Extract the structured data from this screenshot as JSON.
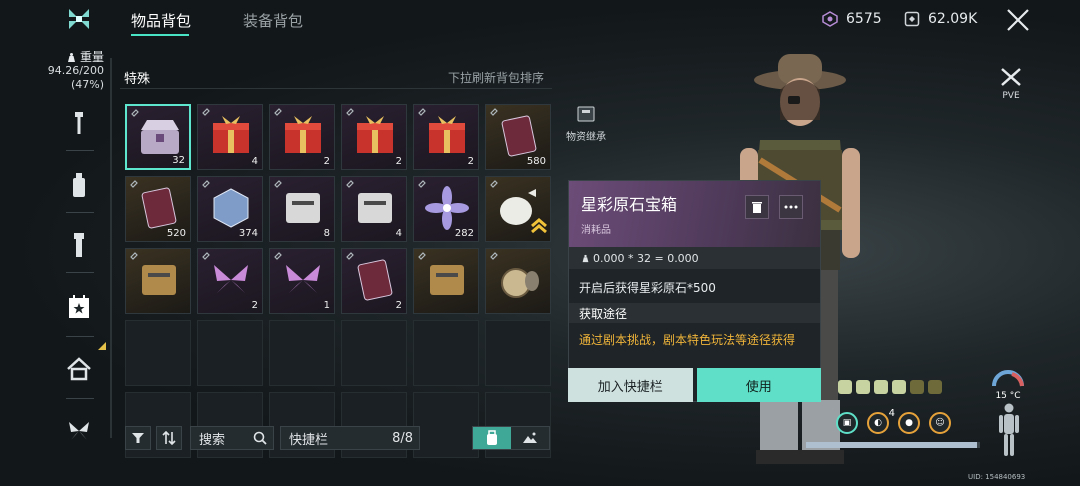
{
  "header": {
    "tabs": [
      {
        "label": "物品背包",
        "active": true
      },
      {
        "label": "装备背包",
        "active": false
      }
    ],
    "currency_gem": "6575",
    "currency_credit": "62.09K"
  },
  "left": {
    "weight_label": "重量",
    "weight_value": "94.26/200",
    "weight_pct": "(47%)",
    "rail_icons": [
      "wrench-icon",
      "bottle-icon",
      "flashlight-icon",
      "calendar-star-icon",
      "house-icon",
      "butterfly-icon"
    ]
  },
  "panel": {
    "category": "特殊",
    "refresh_hint": "下拉刷新背包排序",
    "slots": [
      {
        "item": "星彩原石宝箱",
        "qty": "32",
        "style": "purple",
        "selected": true
      },
      {
        "item": "礼盒",
        "qty": "4",
        "style": "purple"
      },
      {
        "item": "礼盒",
        "qty": "2",
        "style": "purple"
      },
      {
        "item": "礼盒",
        "qty": "2",
        "style": "purple"
      },
      {
        "item": "礼盒",
        "qty": "2",
        "style": "purple"
      },
      {
        "item": "卡片",
        "qty": "580",
        "style": "gold"
      },
      {
        "item": "卡片",
        "qty": "520",
        "style": "gold"
      },
      {
        "item": "魔方",
        "qty": "374",
        "style": "purple"
      },
      {
        "item": "盒子",
        "qty": "8",
        "style": "purple"
      },
      {
        "item": "背包",
        "qty": "4",
        "style": "purple"
      },
      {
        "item": "花",
        "qty": "282",
        "style": "purple"
      },
      {
        "item": "袋子",
        "qty": "",
        "style": "gold"
      },
      {
        "item": "地图",
        "qty": "",
        "style": "gold"
      },
      {
        "item": "蝴蝶",
        "qty": "2",
        "style": "purple"
      },
      {
        "item": "蝴蝶",
        "qty": "1",
        "style": "purple"
      },
      {
        "item": "卡片",
        "qty": "2",
        "style": "purple"
      },
      {
        "item": "文件",
        "qty": "",
        "style": "gold"
      },
      {
        "item": "怀表",
        "qty": "",
        "style": "gold"
      }
    ],
    "side_button_label": "物资继承"
  },
  "toolbar": {
    "search_label": "搜索",
    "quickbar_label": "快捷栏",
    "quickbar_count": "8/8"
  },
  "popup": {
    "name": "星彩原石宝箱",
    "type": "消耗品",
    "weight": "0.000 * 32 = 0.000",
    "description": "开启后获得星彩原石*500",
    "source_title": "获取途径",
    "source_text": "通过剧本挑战，剧本特色玩法等途径获得",
    "btn_quickbar": "加入快捷栏",
    "btn_use": "使用"
  },
  "right": {
    "mode_label": "PVE",
    "temperature": "15 °C",
    "gauge_badge": "4",
    "stamina_pct": 0.98,
    "uid": "UID: 154840693"
  },
  "colors": {
    "accent": "#5fdfc7",
    "source_text": "#f0b43a",
    "popup_header": "#6c4c78"
  }
}
